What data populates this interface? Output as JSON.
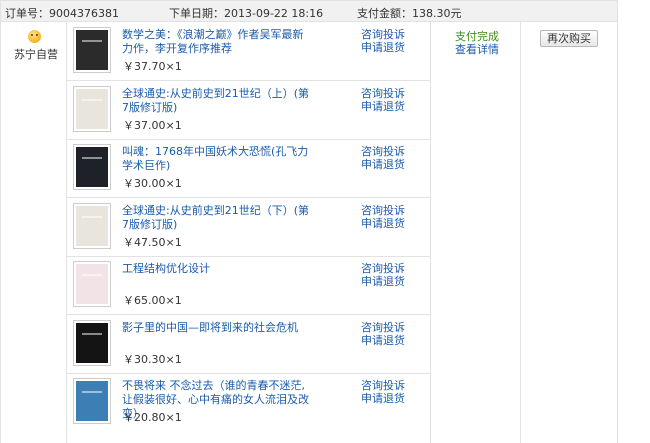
{
  "order": {
    "number_label": "订单号：",
    "number": "9004376381",
    "date_label": "下单日期：",
    "date": "2013-09-22 18:16",
    "amount_label": "支付金额：",
    "amount": "138.30元"
  },
  "shop": {
    "name": "苏宁自营",
    "icon": "smiley-icon"
  },
  "status": {
    "text": "支付完成",
    "detail_link": "查看详情",
    "color": "#3e8a16"
  },
  "rebuy_label": "再次购买",
  "actions": {
    "consult": "咨询投诉",
    "refund": "申请退货"
  },
  "items": [
    {
      "title": "数学之美：《浪潮之巅》作者吴军最新力作，李开复作序推荐",
      "price": "￥37.70×1",
      "cover_color": "#2b2b2b"
    },
    {
      "title": "全球通史:从史前史到21世纪（上）(第7版修订版)",
      "price": "￥37.00×1",
      "cover_color": "#e8e6dc"
    },
    {
      "title": "叫魂：1768年中国妖术大恐慌(孔飞力 学术巨作)",
      "price": "￥30.00×1",
      "cover_color": "#1e2128"
    },
    {
      "title": "全球通史:从史前史到21世纪（下）(第7版修订版)",
      "price": "￥47.50×1",
      "cover_color": "#e8e6dc"
    },
    {
      "title": "工程结构优化设计",
      "price": "￥65.00×1",
      "cover_color": "#f2e4e6"
    },
    {
      "title": "影子里的中国—即将到来的社会危机",
      "price": "￥30.30×1",
      "cover_color": "#141414"
    },
    {
      "title": "不畏将来 不念过去（谁的青春不迷茫,让假装很好、心中有痛的女人流泪及改变）",
      "price": "￥20.80×1",
      "cover_color": "#3d7fb4"
    }
  ]
}
